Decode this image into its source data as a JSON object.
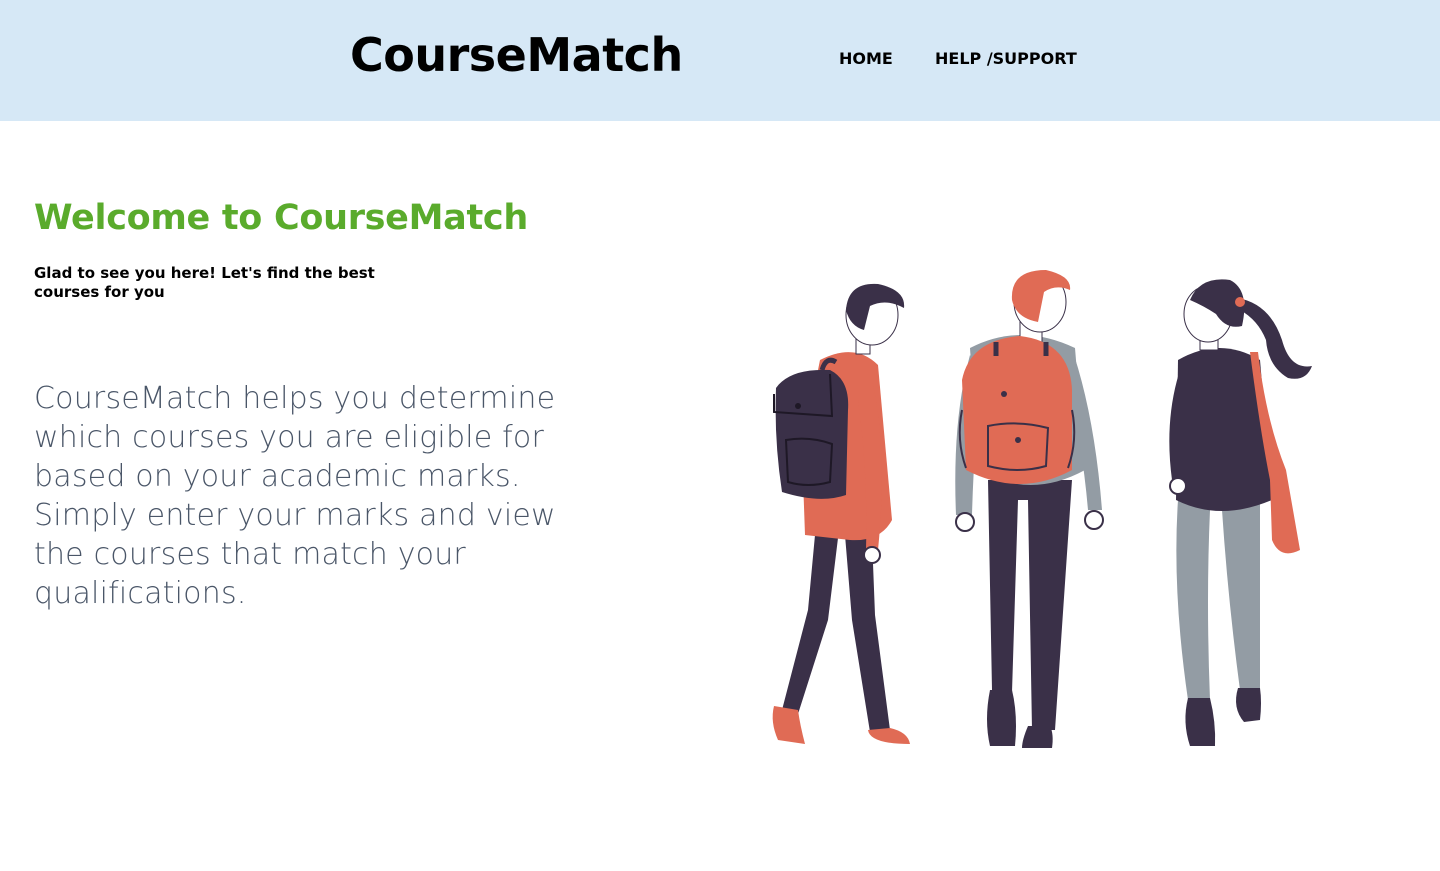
{
  "header": {
    "logo": "CourseMatch",
    "nav": {
      "home": "HOME",
      "help": "HELP /SUPPORT"
    }
  },
  "hero": {
    "title": "Welcome to CourseMatch",
    "tagline": "Glad to see you here! Let's find the best courses for you",
    "description": "CourseMatch helps you determine which courses you are eligible for based on your academic marks. Simply enter your marks and view the courses that match your qualifications."
  },
  "illustration": {
    "icon": "three-students-walking-illustration"
  },
  "colors": {
    "header_bg": "#d6e8f6",
    "accent_green": "#5aab2c",
    "coral": "#e06b55",
    "navy": "#3a3048",
    "grey": "#939ca4"
  }
}
